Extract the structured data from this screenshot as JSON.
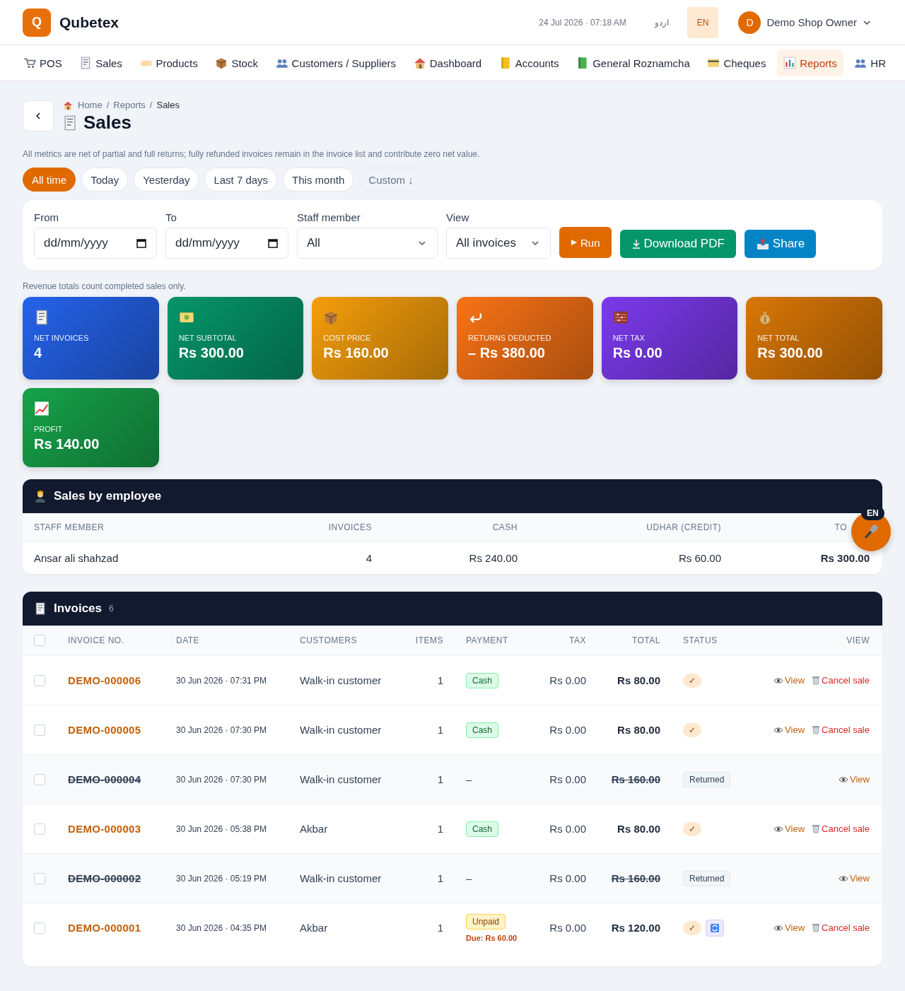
{
  "app": {
    "logo_letter": "Q",
    "name": "Qubetex",
    "datetime": "24 Jul 2026 · 07:18 AM",
    "languages": [
      {
        "label": "اردو",
        "selected": false
      },
      {
        "label": "EN",
        "selected": true
      }
    ],
    "user": {
      "initial": "D",
      "name": "Demo Shop Owner"
    }
  },
  "nav": [
    {
      "label": "POS",
      "selected": false
    },
    {
      "label": "Sales",
      "selected": false
    },
    {
      "label": "Products",
      "selected": false
    },
    {
      "label": "Stock",
      "selected": false
    },
    {
      "label": "Customers / Suppliers",
      "selected": false
    },
    {
      "label": "Dashboard",
      "selected": false
    },
    {
      "label": "Accounts",
      "selected": false
    },
    {
      "label": "General Roznamcha",
      "selected": false
    },
    {
      "label": "Cheques",
      "selected": false
    },
    {
      "label": "Reports",
      "selected": true
    },
    {
      "label": "HR",
      "selected": false
    }
  ],
  "breadcrumb": [
    "Home",
    "Reports",
    "Sales"
  ],
  "breadcrumb_separator": "/",
  "page_title": "Sales",
  "note": "All metrics are net of partial and full returns; fully refunded invoices remain in the invoice list and contribute zero net value.",
  "date_presets": [
    {
      "label": "All time",
      "selected": true,
      "kind": "preset"
    },
    {
      "label": "Today",
      "selected": false,
      "kind": "preset"
    },
    {
      "label": "Yesterday",
      "selected": false,
      "kind": "preset"
    },
    {
      "label": "Last 7 days",
      "selected": false,
      "kind": "preset"
    },
    {
      "label": "This month",
      "selected": false,
      "kind": "preset"
    },
    {
      "label": "Custom ↓",
      "selected": false,
      "kind": "custom"
    }
  ],
  "filters": {
    "fields": [
      {
        "label": "From",
        "kind": "date",
        "placeholder": "dd/mm/yyyy"
      },
      {
        "label": "To",
        "kind": "date",
        "placeholder": "dd/mm/yyyy"
      },
      {
        "label": "Staff member",
        "kind": "select",
        "value": "All"
      },
      {
        "label": "View",
        "kind": "select",
        "value": "All invoices"
      }
    ],
    "buttons": [
      {
        "label": "Run",
        "kind": "run"
      },
      {
        "label": "Download PDF",
        "kind": "download"
      },
      {
        "label": "Share",
        "kind": "share"
      }
    ]
  },
  "revenue_note": "Revenue totals count completed sales only.",
  "metrics": [
    {
      "label": "NET INVOICES",
      "value": "4",
      "color": "#2563eb"
    },
    {
      "label": "NET SUBTOTAL",
      "value": "Rs 300.00",
      "color": "#059669"
    },
    {
      "label": "COST PRICE",
      "value": "Rs 160.00",
      "color": "#f59e0b"
    },
    {
      "label": "RETURNS DEDUCTED",
      "value": "– Rs 380.00",
      "color": "#f97316"
    },
    {
      "label": "NET TAX",
      "value": "Rs 0.00",
      "color": "#7c3aed"
    },
    {
      "label": "NET TOTAL",
      "value": "Rs 300.00",
      "color": "#d97706"
    },
    {
      "label": "PROFIT",
      "value": "Rs 140.00",
      "color": "#16a34a"
    }
  ],
  "employees": {
    "title": "Sales by employee",
    "columns": [
      "STAFF MEMBER",
      "INVOICES",
      "CASH",
      "UDHAR (CREDIT)",
      "TO"
    ],
    "rows": [
      [
        "Ansar ali shahzad",
        "4",
        "Rs 240.00",
        "Rs 60.00",
        "Rs 300.00"
      ]
    ]
  },
  "voice": {
    "language": "EN"
  },
  "invoices": {
    "title": "Invoices",
    "count": "6",
    "all_checked": false,
    "columns": [
      "INVOICE NO.",
      "DATE",
      "CUSTOMERS",
      "ITEMS",
      "PAYMENT",
      "TAX",
      "TOTAL",
      "STATUS",
      "VIEW"
    ],
    "rows": [
      {
        "checked": false,
        "number": "DEMO-000006",
        "date": "30 Jun 2026 · 07:31 PM",
        "customer": "Walk-in customer",
        "items": "1",
        "payment": {
          "kind": "cash",
          "label": "Cash"
        },
        "tax": "Rs 0.00",
        "total": "Rs 80.00",
        "returned": false,
        "status": {
          "kind": "done",
          "label": "✓"
        },
        "has_exchange": false,
        "actions": [
          {
            "kind": "view",
            "label": "View"
          },
          {
            "kind": "cancel",
            "label": "Cancel sale"
          }
        ]
      },
      {
        "checked": false,
        "number": "DEMO-000005",
        "date": "30 Jun 2026 · 07:30 PM",
        "customer": "Walk-in customer",
        "items": "1",
        "payment": {
          "kind": "cash",
          "label": "Cash"
        },
        "tax": "Rs 0.00",
        "total": "Rs 80.00",
        "returned": false,
        "status": {
          "kind": "done",
          "label": "✓"
        },
        "has_exchange": false,
        "actions": [
          {
            "kind": "view",
            "label": "View"
          },
          {
            "kind": "cancel",
            "label": "Cancel sale"
          }
        ]
      },
      {
        "checked": false,
        "number": "DEMO-000004",
        "date": "30 Jun 2026 · 07:30 PM",
        "customer": "Walk-in customer",
        "items": "1",
        "payment": {
          "kind": "none",
          "label": "–"
        },
        "tax": "Rs 0.00",
        "total": "Rs 160.00",
        "returned": true,
        "status": {
          "kind": "returned",
          "label": "Returned"
        },
        "has_exchange": false,
        "actions": [
          {
            "kind": "view",
            "label": "View"
          }
        ]
      },
      {
        "checked": false,
        "number": "DEMO-000003",
        "date": "30 Jun 2026 · 05:38 PM",
        "customer": "Akbar",
        "items": "1",
        "payment": {
          "kind": "cash",
          "label": "Cash"
        },
        "tax": "Rs 0.00",
        "total": "Rs 80.00",
        "returned": false,
        "status": {
          "kind": "done",
          "label": "✓"
        },
        "has_exchange": false,
        "actions": [
          {
            "kind": "view",
            "label": "View"
          },
          {
            "kind": "cancel",
            "label": "Cancel sale"
          }
        ]
      },
      {
        "checked": false,
        "number": "DEMO-000002",
        "date": "30 Jun 2026 · 05:19 PM",
        "customer": "Walk-in customer",
        "items": "1",
        "payment": {
          "kind": "none",
          "label": "–"
        },
        "tax": "Rs 0.00",
        "total": "Rs 160.00",
        "returned": true,
        "status": {
          "kind": "returned",
          "label": "Returned"
        },
        "has_exchange": false,
        "actions": [
          {
            "kind": "view",
            "label": "View"
          }
        ]
      },
      {
        "checked": false,
        "number": "DEMO-000001",
        "date": "30 Jun 2026 · 04:35 PM",
        "customer": "Akbar",
        "items": "1",
        "payment": {
          "kind": "unpaid",
          "label": "Unpaid",
          "due": "Due: Rs 60.00"
        },
        "tax": "Rs 0.00",
        "total": "Rs 120.00",
        "returned": false,
        "status": {
          "kind": "done",
          "label": "✓"
        },
        "has_exchange": true,
        "actions": [
          {
            "kind": "view",
            "label": "View"
          },
          {
            "kind": "cancel",
            "label": "Cancel sale"
          }
        ]
      }
    ]
  }
}
